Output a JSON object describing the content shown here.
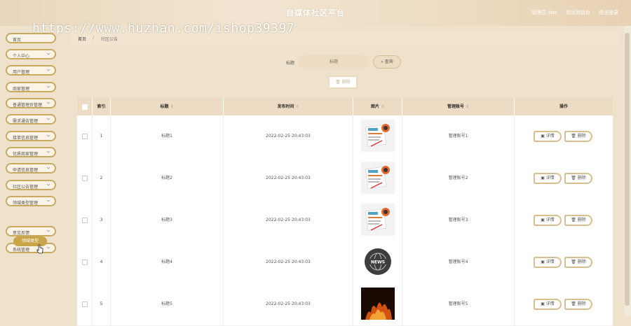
{
  "header": {
    "title": "自媒体社区平台",
    "user_label": "管理员 abo",
    "back_label": "退出到前台",
    "logout_label": "退出登录"
  },
  "watermark": "https://www.huzhan.com/ishop39397",
  "sidebar": {
    "items": [
      {
        "label": "首页",
        "has_chevron": false
      },
      {
        "label": "个人中心",
        "has_chevron": true
      },
      {
        "label": "用户管理",
        "has_chevron": true
      },
      {
        "label": "商家管理",
        "has_chevron": true
      },
      {
        "label": "普通管理员管理",
        "has_chevron": true
      },
      {
        "label": "需求通告管理",
        "has_chevron": true
      },
      {
        "label": "接单信息管理",
        "has_chevron": true
      },
      {
        "label": "优质商家管理",
        "has_chevron": true
      },
      {
        "label": "申请信息管理",
        "has_chevron": true
      },
      {
        "label": "社区公告管理",
        "has_chevron": true
      },
      {
        "label": "领域类型管理",
        "has_chevron": true
      },
      {
        "label": "意见反馈",
        "has_chevron": true
      },
      {
        "label": "系统管理",
        "has_chevron": true
      }
    ],
    "sub_item": "领域类型"
  },
  "breadcrumb": {
    "home": "首页",
    "separator": "/",
    "current": "社区公告"
  },
  "search": {
    "label": "标题",
    "placeholder": "标题",
    "button_label": "查询",
    "delete_label": "删除"
  },
  "table": {
    "columns": [
      "",
      "索引",
      "标题",
      "发布时间",
      "图片",
      "管理账号",
      "操作"
    ],
    "rows": [
      {
        "index": "1",
        "title": "标题1",
        "time": "2022-02-25 20:43:03",
        "image": "news-doc",
        "account": "管理账号1"
      },
      {
        "index": "2",
        "title": "标题2",
        "time": "2022-02-25 20:43:03",
        "image": "news-doc",
        "account": "管理账号2"
      },
      {
        "index": "3",
        "title": "标题3",
        "time": "2022-02-25 20:43:03",
        "image": "news-doc",
        "account": "管理账号3"
      },
      {
        "index": "4",
        "title": "标题4",
        "time": "2022-02-25 20:43:03",
        "image": "news-globe",
        "account": "管理账号4"
      },
      {
        "index": "5",
        "title": "标题5",
        "time": "2022-02-25 20:43:03",
        "image": "news-fire",
        "account": "管理账号5"
      }
    ],
    "detail_label": "详情",
    "delete_label": "删除"
  },
  "colors": {
    "accent": "#c9a95d",
    "header_bg": "#e9d7bd",
    "table_head": "#eddcc3"
  }
}
